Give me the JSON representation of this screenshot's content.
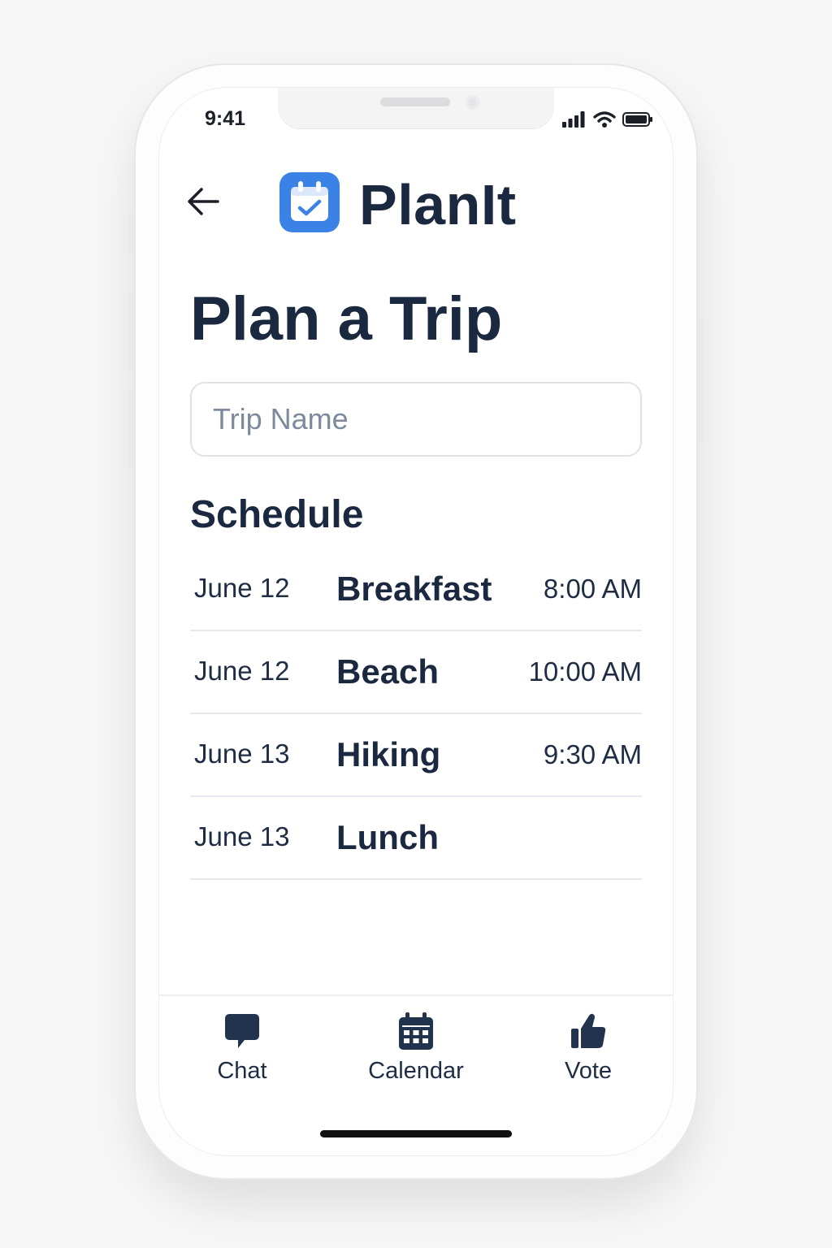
{
  "status_bar": {
    "time": "9:41"
  },
  "header": {
    "app_name": "PlanIt",
    "back_icon": "arrow-left-icon",
    "logo_icon": "calendar-check-icon",
    "accent_color": "#3b82e6"
  },
  "page": {
    "title": "Plan a Trip",
    "trip_name_placeholder": "Trip Name",
    "trip_name_value": ""
  },
  "schedule": {
    "title": "Schedule",
    "rows": [
      {
        "date": "June 12",
        "event": "Breakfast",
        "time": "8:00 AM"
      },
      {
        "date": "June 12",
        "event": "Beach",
        "time": "10:00 AM"
      },
      {
        "date": "June 13",
        "event": "Hiking",
        "time": "9:30 AM"
      },
      {
        "date": "June 13",
        "event": "Lunch",
        "time": ""
      }
    ]
  },
  "tab_bar": {
    "tabs": [
      {
        "label": "Chat",
        "icon": "chat-bubble-icon"
      },
      {
        "label": "Calendar",
        "icon": "calendar-icon"
      },
      {
        "label": "Vote",
        "icon": "thumbs-up-icon"
      }
    ]
  }
}
